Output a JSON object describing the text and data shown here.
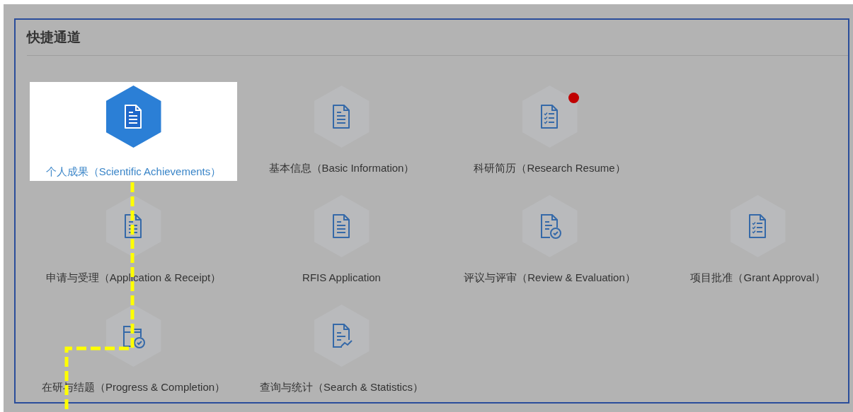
{
  "panel": {
    "title": "快捷通道"
  },
  "rows": [
    [
      {
        "label": "个人成果（Scientific Achievements）",
        "kind": "doc",
        "selected": true,
        "badge": false
      },
      {
        "label": "基本信息（Basic Information）",
        "kind": "doc",
        "selected": false,
        "badge": false
      },
      {
        "label": "科研简历（Research Resume）",
        "kind": "checklist",
        "selected": false,
        "badge": true
      }
    ],
    [
      {
        "label": "申请与受理（Application & Receipt）",
        "kind": "doc",
        "selected": false,
        "badge": false
      },
      {
        "label": "RFIS Application",
        "kind": "doc",
        "selected": false,
        "badge": false
      },
      {
        "label": "评议与评审（Review & Evaluation）",
        "kind": "review",
        "selected": false,
        "badge": false
      },
      {
        "label": "项目批准（Grant Approval）",
        "kind": "checklist",
        "selected": false,
        "badge": false
      }
    ],
    [
      {
        "label": "在研与结题（Progress & Completion）",
        "kind": "folder",
        "selected": false,
        "badge": false
      },
      {
        "label": "查询与统计（Search & Statistics）",
        "kind": "stats",
        "selected": false,
        "badge": false
      }
    ]
  ]
}
